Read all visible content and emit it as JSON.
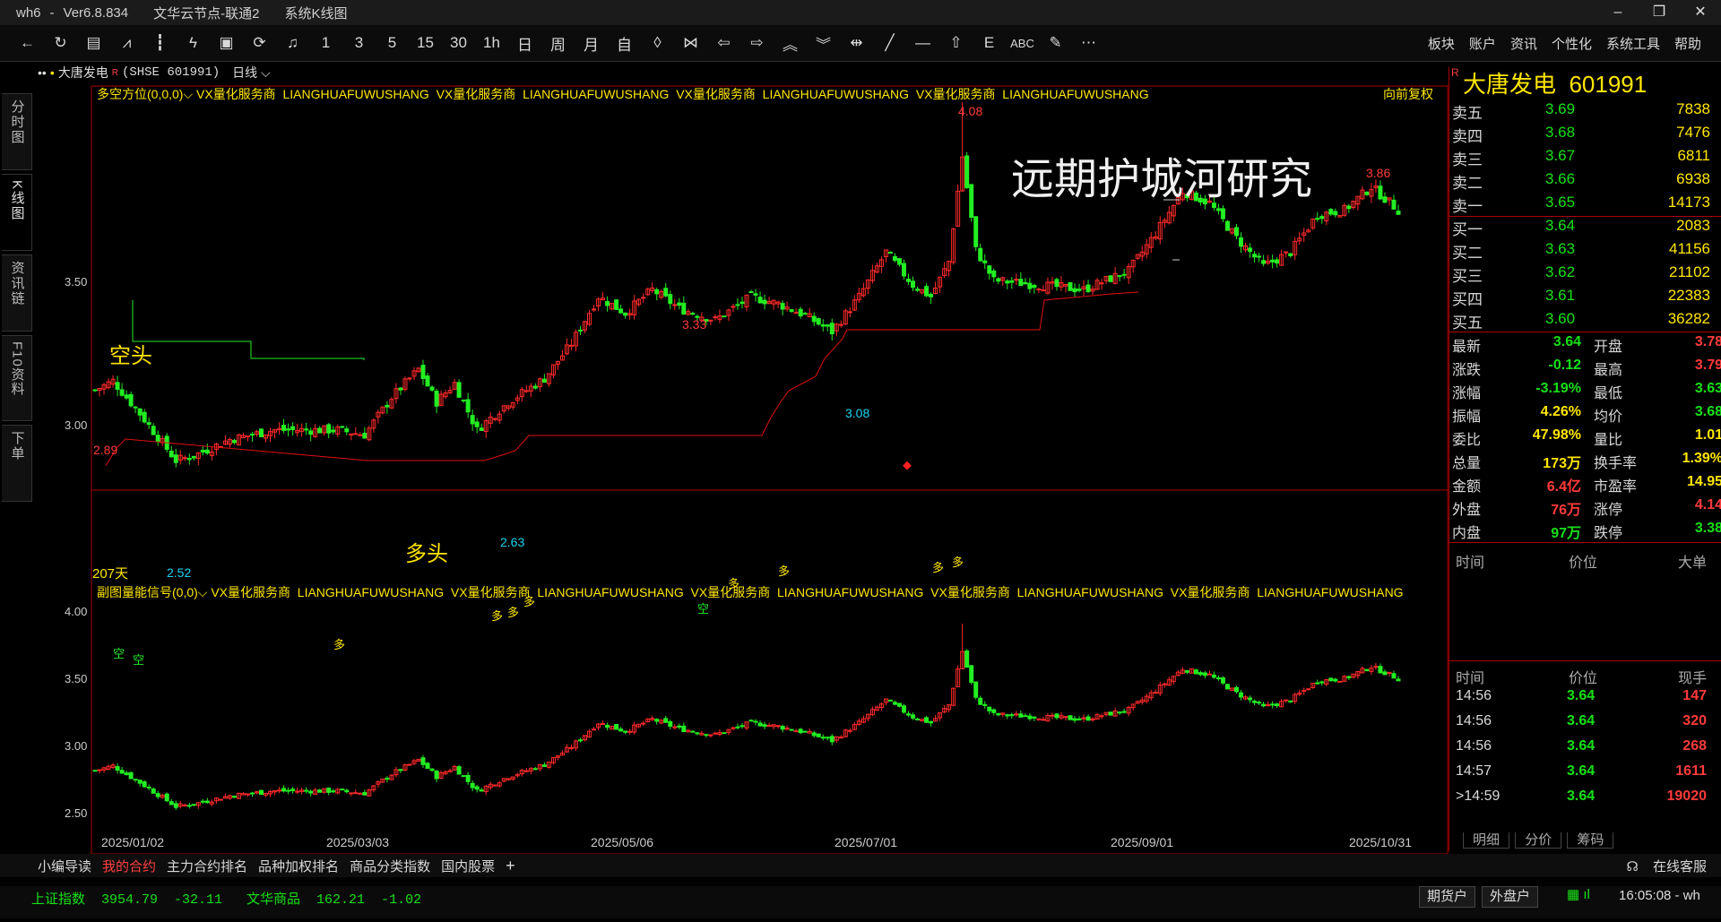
{
  "titlebar": {
    "app": "wh6",
    "dash": "-",
    "version": "Ver6.8.834",
    "node": "文华云节点-联通2",
    "view": "系统K线图",
    "min": "–",
    "max": "❐",
    "close": "✕"
  },
  "toolbar": {
    "icons": [
      "back-arrow-icon",
      "refresh-icon",
      "table-icon",
      "line-chart-icon",
      "kline-icon",
      "tick-icon",
      "box-icon",
      "cycle-icon",
      "bell-icon"
    ],
    "periods": [
      "1",
      "3",
      "5",
      "15",
      "30",
      "1h",
      "日",
      "周",
      "月",
      "自"
    ],
    "menu": [
      "板块",
      "账户",
      "资讯",
      "个性化",
      "系统工具",
      "帮助"
    ]
  },
  "left_tabs": [
    "分时图",
    "K线图",
    "资讯链",
    "F10资料",
    "下单"
  ],
  "chart_header": {
    "dots": "••",
    "bullet": "•",
    "stock": "大唐发电",
    "sup": "R",
    "code": "(SHSE 601991)",
    "period": "日线",
    "caret": "⌵"
  },
  "main_indicator": {
    "name": "多空方位(0,0,0)",
    "ads": [
      "VX量化服务商",
      "LIANGHUAFUWUSHANG",
      "VX量化服务商",
      "LIANGHUAFUWUSHANG",
      "VX量化服务商",
      "LIANGHUAFUWUSHANG",
      "VX量化服务商",
      "LIANGHUAFUWUSHANG"
    ],
    "adjust": "向前复权"
  },
  "sub_indicator": {
    "name": "副图量能信号(0,0)",
    "ads": [
      "VX量化服务商",
      "LIANGHUAFUWUSHANG",
      "VX量化服务商",
      "LIANGHUAFUWUSHANG",
      "VX量化服务商",
      "LIANGHUAFUWUSHANG",
      "VX量化服务商",
      "LIANGHUAFUWUSHANG",
      "VX量化服务商",
      "LIANGHUAFUWUSHANG"
    ]
  },
  "watermark": "远期护城河研究",
  "annotations": {
    "kongtou": "空头",
    "duotou": "多头",
    "days": "207天",
    "markers": [
      "2.89",
      "2.52",
      "2.63",
      "3.33",
      "3.08",
      "4.08",
      "3.86"
    ]
  },
  "y_axis_main": [
    "3.50",
    "3.00"
  ],
  "y_axis_sub": [
    "4.00",
    "3.50",
    "3.00",
    "2.50"
  ],
  "x_axis": [
    "2025/01/02",
    "2025/03/03",
    "2025/05/06",
    "2025/07/01",
    "2025/09/01",
    "2025/10/31"
  ],
  "signals": {
    "kong": "空",
    "duo": "多"
  },
  "chart_data": {
    "type": "candlestick",
    "x": [
      "2025/01/02",
      "2025/03/03",
      "2025/05/06",
      "2025/07/01",
      "2025/09/01",
      "2025/10/31"
    ],
    "close_approx": [
      2.85,
      2.68,
      3.2,
      3.16,
      3.3,
      3.64
    ],
    "highs_marked": [
      2.89,
      3.33,
      4.08,
      3.86
    ],
    "lows_marked": [
      2.52,
      2.63,
      3.08
    ],
    "ylim_main": [
      2.45,
      4.15
    ],
    "ylim_sub": [
      2.4,
      4.05
    ]
  },
  "quote": {
    "name": "大唐发电",
    "code": "601991",
    "flag": "R",
    "asks": [
      {
        "l": "卖五",
        "p": "3.69",
        "v": "7838"
      },
      {
        "l": "卖四",
        "p": "3.68",
        "v": "7476"
      },
      {
        "l": "卖三",
        "p": "3.67",
        "v": "6811"
      },
      {
        "l": "卖二",
        "p": "3.66",
        "v": "6938"
      },
      {
        "l": "卖一",
        "p": "3.65",
        "v": "14173"
      }
    ],
    "bids": [
      {
        "l": "买一",
        "p": "3.64",
        "v": "2083"
      },
      {
        "l": "买二",
        "p": "3.63",
        "v": "41156"
      },
      {
        "l": "买三",
        "p": "3.62",
        "v": "21102"
      },
      {
        "l": "买四",
        "p": "3.61",
        "v": "22383"
      },
      {
        "l": "买五",
        "p": "3.60",
        "v": "36282"
      }
    ],
    "stats_left": [
      {
        "l": "最新",
        "v": "3.64",
        "c": "g"
      },
      {
        "l": "涨跌",
        "v": "-0.12",
        "c": "g"
      },
      {
        "l": "涨幅",
        "v": "-3.19%",
        "c": "g"
      },
      {
        "l": "振幅",
        "v": "4.26%",
        "c": "y"
      },
      {
        "l": "委比",
        "v": "47.98%",
        "c": "y"
      },
      {
        "l": "总量",
        "v": "173万",
        "c": "y"
      },
      {
        "l": "金额",
        "v": "6.4亿",
        "c": "r"
      },
      {
        "l": "外盘",
        "v": "76万",
        "c": "r"
      },
      {
        "l": "内盘",
        "v": "97万",
        "c": "g"
      }
    ],
    "stats_right": [
      {
        "l": "开盘",
        "v": "3.78",
        "c": "r"
      },
      {
        "l": "最高",
        "v": "3.79",
        "c": "r"
      },
      {
        "l": "最低",
        "v": "3.63",
        "c": "g"
      },
      {
        "l": "均价",
        "v": "3.68",
        "c": "g"
      },
      {
        "l": "量比",
        "v": "1.01",
        "c": "y"
      },
      {
        "l": "换手率",
        "v": "1.39%",
        "c": "y"
      },
      {
        "l": "市盈率",
        "v": "14.95",
        "c": "y"
      },
      {
        "l": "涨停",
        "v": "4.14",
        "c": "r"
      },
      {
        "l": "跌停",
        "v": "3.38",
        "c": "g"
      }
    ],
    "big_header": {
      "t": "时间",
      "p": "价位",
      "v": "大单"
    },
    "tick_header": {
      "t": "时间",
      "p": "价位",
      "v": "现手"
    },
    "ticks": [
      {
        "t": "14:56",
        "p": "3.64",
        "v": "147"
      },
      {
        "t": "14:56",
        "p": "3.64",
        "v": "320"
      },
      {
        "t": "14:56",
        "p": "3.64",
        "v": "268"
      },
      {
        "t": "14:57",
        "p": "3.64",
        "v": "1611"
      },
      {
        "t": "14:59",
        "p": "3.64",
        "v": "19020",
        "cur": ">"
      }
    ],
    "tabs": [
      "明细",
      "分价",
      "筹码"
    ]
  },
  "bottom_tabs": [
    "小编导读",
    "我的合约",
    "主力合约排名",
    "品种加权排名",
    "商品分类指数",
    "国内股票",
    "+"
  ],
  "online_service": "在线客服",
  "status": {
    "index1": "上证指数  3954.79  -32.11",
    "index2": "文华商品  162.21  -1.02",
    "btn1": "期货户",
    "btn2": "外盘户",
    "time": "16:05:08 - wh"
  }
}
